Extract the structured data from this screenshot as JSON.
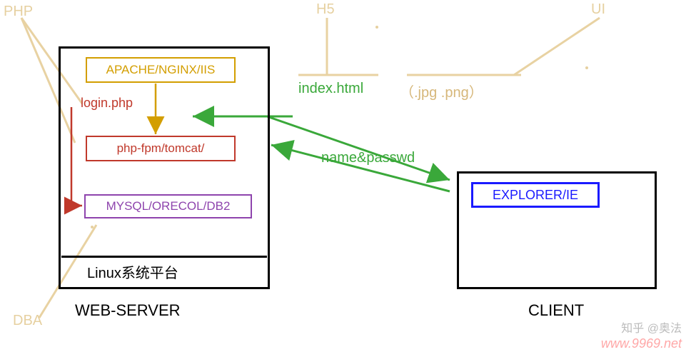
{
  "labels": {
    "php": "PHP",
    "h5": "H5",
    "ui": "UI",
    "dba": "DBA"
  },
  "server": {
    "apache": "APACHE/NGINX/IIS",
    "login": "login.php",
    "phpfpm": "php-fpm/tomcat/",
    "mysql": "MYSQL/ORECOL/DB2",
    "linux": "Linux系统平台",
    "title": "WEB-SERVER"
  },
  "client": {
    "explorer": "EXPLORER/IE",
    "title": "CLIENT"
  },
  "net": {
    "index": "index.html",
    "img": "（.jpg .png）",
    "namepass": "name&passwd"
  },
  "watermark": {
    "zhihu": "知乎 @奥法",
    "url": "www.9969.net"
  }
}
